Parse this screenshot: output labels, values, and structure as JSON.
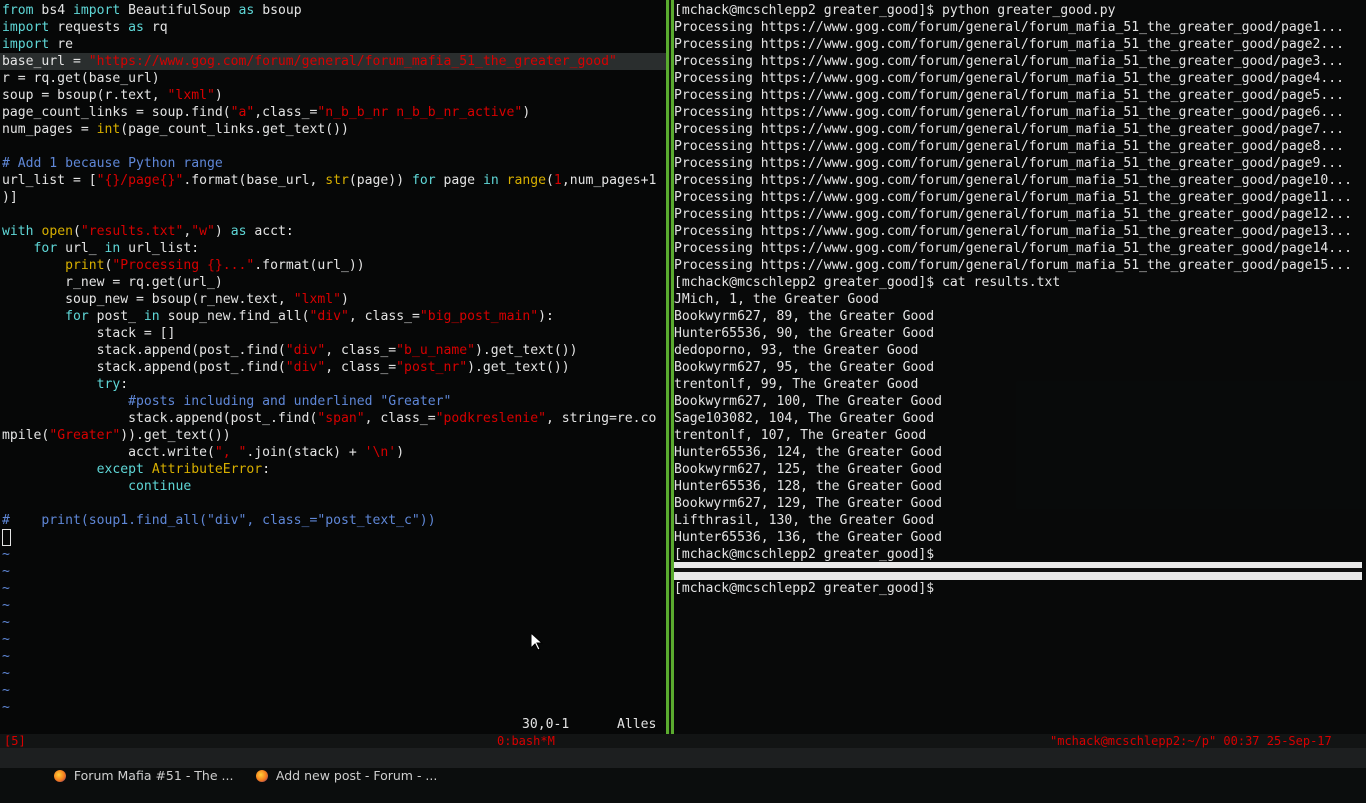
{
  "vim": {
    "lines": [
      [
        {
          "t": "from",
          "c": "kw"
        },
        {
          "t": " bs4 "
        },
        {
          "t": "import",
          "c": "kw"
        },
        {
          "t": " BeautifulSoup "
        },
        {
          "t": "as",
          "c": "kw"
        },
        {
          "t": " bsoup"
        }
      ],
      [
        {
          "t": "import",
          "c": "kw"
        },
        {
          "t": " requests "
        },
        {
          "t": "as",
          "c": "kw"
        },
        {
          "t": " rq"
        }
      ],
      [
        {
          "t": "import",
          "c": "kw"
        },
        {
          "t": " re"
        }
      ],
      [
        {
          "t": "base_url = "
        },
        {
          "t": "\"https://www.gog.com/forum/general/forum_mafia_51_the_greater_good\"",
          "c": "st"
        }
      ],
      [
        {
          "t": "r = rq.get(base_url)"
        }
      ],
      [
        {
          "t": "soup = bsoup(r.text, "
        },
        {
          "t": "\"lxml\"",
          "c": "st"
        },
        {
          "t": ")"
        }
      ],
      [
        {
          "t": "page_count_links = soup.find("
        },
        {
          "t": "\"a\"",
          "c": "st"
        },
        {
          "t": ",class_="
        },
        {
          "t": "\"n_b_b_nr n_b_b_nr_active\"",
          "c": "st"
        },
        {
          "t": ")"
        }
      ],
      [
        {
          "t": "num_pages = "
        },
        {
          "t": "int",
          "c": "bi"
        },
        {
          "t": "(page_count_links.get_text())"
        }
      ],
      [],
      [
        {
          "t": "# Add 1 because Python range",
          "c": "cm"
        }
      ],
      [
        {
          "t": "url_list = ["
        },
        {
          "t": "\"{}/page{}\"",
          "c": "st"
        },
        {
          "t": ".format(base_url, "
        },
        {
          "t": "str",
          "c": "bi"
        },
        {
          "t": "(page)) "
        },
        {
          "t": "for",
          "c": "kw"
        },
        {
          "t": " page "
        },
        {
          "t": "in",
          "c": "kw"
        },
        {
          "t": " "
        },
        {
          "t": "range",
          "c": "bi"
        },
        {
          "t": "("
        },
        {
          "t": "1",
          "c": "st"
        },
        {
          "t": ",num_pages+1"
        }
      ],
      [
        {
          "t": ")]"
        }
      ],
      [],
      [
        {
          "t": "with",
          "c": "kw"
        },
        {
          "t": " "
        },
        {
          "t": "open",
          "c": "bi"
        },
        {
          "t": "("
        },
        {
          "t": "\"results.txt\"",
          "c": "st"
        },
        {
          "t": ","
        },
        {
          "t": "\"w\"",
          "c": "st"
        },
        {
          "t": ") "
        },
        {
          "t": "as",
          "c": "kw"
        },
        {
          "t": " acct:"
        }
      ],
      [
        {
          "t": "    "
        },
        {
          "t": "for",
          "c": "kw"
        },
        {
          "t": " url_ "
        },
        {
          "t": "in",
          "c": "kw"
        },
        {
          "t": " url_list:"
        }
      ],
      [
        {
          "t": "        "
        },
        {
          "t": "print",
          "c": "bi"
        },
        {
          "t": "("
        },
        {
          "t": "\"Processing {}...\"",
          "c": "st"
        },
        {
          "t": ".format(url_))"
        }
      ],
      [
        {
          "t": "        r_new = rq.get(url_)"
        }
      ],
      [
        {
          "t": "        soup_new = bsoup(r_new.text, "
        },
        {
          "t": "\"lxml\"",
          "c": "st"
        },
        {
          "t": ")"
        }
      ],
      [
        {
          "t": "        "
        },
        {
          "t": "for",
          "c": "kw"
        },
        {
          "t": " post_ "
        },
        {
          "t": "in",
          "c": "kw"
        },
        {
          "t": " soup_new.find_all("
        },
        {
          "t": "\"div\"",
          "c": "st"
        },
        {
          "t": ", class_="
        },
        {
          "t": "\"big_post_main\"",
          "c": "st"
        },
        {
          "t": "):"
        }
      ],
      [
        {
          "t": "            stack = []"
        }
      ],
      [
        {
          "t": "            stack.append(post_.find("
        },
        {
          "t": "\"div\"",
          "c": "st"
        },
        {
          "t": ", class_="
        },
        {
          "t": "\"b_u_name\"",
          "c": "st"
        },
        {
          "t": ").get_text())"
        }
      ],
      [
        {
          "t": "            stack.append(post_.find("
        },
        {
          "t": "\"div\"",
          "c": "st"
        },
        {
          "t": ", class_="
        },
        {
          "t": "\"post_nr\"",
          "c": "st"
        },
        {
          "t": ").get_text())"
        }
      ],
      [
        {
          "t": "            "
        },
        {
          "t": "try",
          "c": "kw"
        },
        {
          "t": ":"
        }
      ],
      [
        {
          "t": "                "
        },
        {
          "t": "#posts including and underlined \"Greater\"",
          "c": "cm"
        }
      ],
      [
        {
          "t": "                stack.append(post_.find("
        },
        {
          "t": "\"span\"",
          "c": "st"
        },
        {
          "t": ", class_="
        },
        {
          "t": "\"podkreslenie\"",
          "c": "st"
        },
        {
          "t": ", string=re.co"
        }
      ],
      [
        {
          "t": "mpile("
        },
        {
          "t": "\"Greater\"",
          "c": "st"
        },
        {
          "t": ")).get_text())"
        }
      ],
      [
        {
          "t": "                acct.write("
        },
        {
          "t": "\", \"",
          "c": "st"
        },
        {
          "t": ".join(stack) + "
        },
        {
          "t": "'\\n'",
          "c": "st"
        },
        {
          "t": ")"
        }
      ],
      [
        {
          "t": "            "
        },
        {
          "t": "except",
          "c": "kw"
        },
        {
          "t": " "
        },
        {
          "t": "AttributeError",
          "c": "bi"
        },
        {
          "t": ":"
        }
      ],
      [
        {
          "t": "                "
        },
        {
          "t": "continue",
          "c": "kw"
        }
      ],
      [],
      [
        {
          "t": "#    print(soup1.find_all(\"div\", class_=\"post_text_c\"))",
          "c": "cm"
        }
      ],
      [
        {
          "t": "CURSOR"
        }
      ],
      [
        {
          "t": "~",
          "c": "tl"
        }
      ],
      [
        {
          "t": "~",
          "c": "tl"
        }
      ],
      [
        {
          "t": "~",
          "c": "tl"
        }
      ],
      [
        {
          "t": "~",
          "c": "tl"
        }
      ],
      [
        {
          "t": "~",
          "c": "tl"
        }
      ],
      [
        {
          "t": "~",
          "c": "tl"
        }
      ],
      [
        {
          "t": "~",
          "c": "tl"
        }
      ],
      [
        {
          "t": "~",
          "c": "tl"
        }
      ],
      [
        {
          "t": "~",
          "c": "tl"
        }
      ],
      [
        {
          "t": "~",
          "c": "tl"
        }
      ]
    ],
    "ruler_pos": "30,0-1",
    "ruler_scroll": "Alles"
  },
  "terminal": {
    "lines": [
      "[mchack@mcschlepp2 greater_good]$ python greater_good.py",
      "Processing https://www.gog.com/forum/general/forum_mafia_51_the_greater_good/page1...",
      "Processing https://www.gog.com/forum/general/forum_mafia_51_the_greater_good/page2...",
      "Processing https://www.gog.com/forum/general/forum_mafia_51_the_greater_good/page3...",
      "Processing https://www.gog.com/forum/general/forum_mafia_51_the_greater_good/page4...",
      "Processing https://www.gog.com/forum/general/forum_mafia_51_the_greater_good/page5...",
      "Processing https://www.gog.com/forum/general/forum_mafia_51_the_greater_good/page6...",
      "Processing https://www.gog.com/forum/general/forum_mafia_51_the_greater_good/page7...",
      "Processing https://www.gog.com/forum/general/forum_mafia_51_the_greater_good/page8...",
      "Processing https://www.gog.com/forum/general/forum_mafia_51_the_greater_good/page9...",
      "Processing https://www.gog.com/forum/general/forum_mafia_51_the_greater_good/page10...",
      "Processing https://www.gog.com/forum/general/forum_mafia_51_the_greater_good/page11...",
      "Processing https://www.gog.com/forum/general/forum_mafia_51_the_greater_good/page12...",
      "Processing https://www.gog.com/forum/general/forum_mafia_51_the_greater_good/page13...",
      "Processing https://www.gog.com/forum/general/forum_mafia_51_the_greater_good/page14...",
      "Processing https://www.gog.com/forum/general/forum_mafia_51_the_greater_good/page15...",
      "[mchack@mcschlepp2 greater_good]$ cat results.txt",
      "JMich, 1, the Greater Good",
      "Bookwyrm627, 89, the Greater Good",
      "Hunter65536, 90, the Greater Good",
      "dedoporno, 93, the Greater Good",
      "Bookwyrm627, 95, the Greater Good",
      "trentonlf, 99, The Greater Good",
      "Bookwyrm627, 100, The Greater Good",
      "Sage103082, 104, The Greater Good",
      "trentonlf, 107, The Greater Good",
      "Hunter65536, 124, the Greater Good",
      "Bookwyrm627, 125, the Greater Good",
      "Hunter65536, 128, the Greater Good",
      "Bookwyrm627, 129, The Greater Good",
      "Lifthrasil, 130, the Greater Good",
      "Hunter65536, 136, the Greater Good",
      "[mchack@mcschlepp2 greater_good]$"
    ],
    "bottom_prompt": "[mchack@mcschlepp2 greater_good]$"
  },
  "tmux": {
    "session": "[5]",
    "window": "0:bash*M",
    "status_right": "\"mchack@mcschlepp2:~/p\" 00:37 25-Sep-17"
  },
  "taskbar": {
    "tasks": [
      {
        "label": "Forum Mafia #51 - The ..."
      },
      {
        "label": "Add new post - Forum - ..."
      }
    ]
  },
  "colors": {
    "divider": "#5aab2f",
    "keyword": "#5fd7d7",
    "string": "#d70000",
    "comment": "#5f87d7",
    "builtin": "#d7af00",
    "status": "#d70000"
  }
}
